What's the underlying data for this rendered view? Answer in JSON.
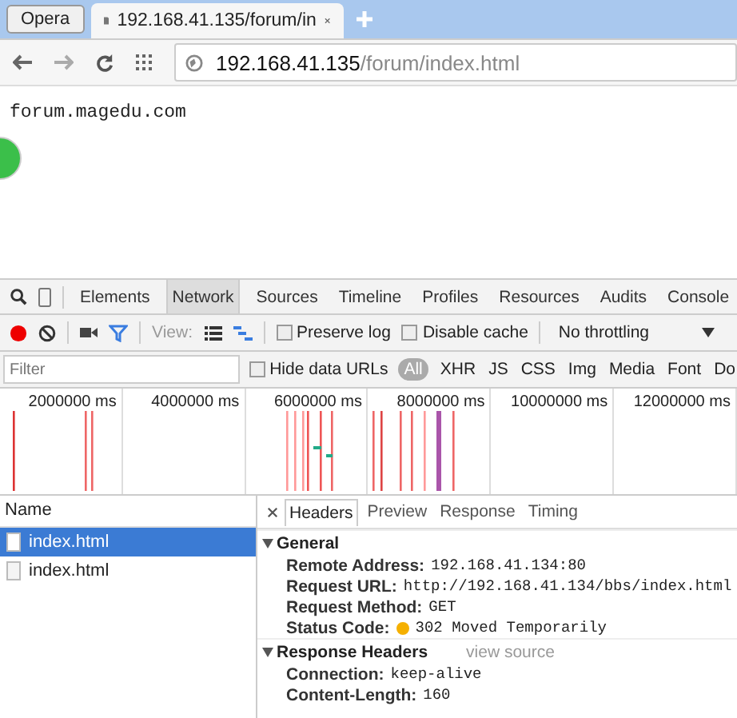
{
  "browser": {
    "menu_button": "Opera",
    "tabs": [
      {
        "title": "192.168.41.135/forum/in",
        "selected": true
      }
    ],
    "address": {
      "host": "192.168.41.135",
      "path": "/forum/index.html"
    }
  },
  "page": {
    "text": "forum.magedu.com"
  },
  "devtools": {
    "panels": [
      {
        "label": "Elements",
        "selected": false
      },
      {
        "label": "Network",
        "selected": true
      },
      {
        "label": "Sources",
        "selected": false
      },
      {
        "label": "Timeline",
        "selected": false
      },
      {
        "label": "Profiles",
        "selected": false
      },
      {
        "label": "Resources",
        "selected": false
      },
      {
        "label": "Audits",
        "selected": false
      },
      {
        "label": "Console",
        "selected": false
      }
    ],
    "toolbar": {
      "recording": true,
      "filter_on": true,
      "view_label": "View:",
      "preserve_log": {
        "label": "Preserve log",
        "checked": false
      },
      "disable_cache": {
        "label": "Disable cache",
        "checked": false
      },
      "throttling": "No throttling"
    },
    "filter": {
      "placeholder": "Filter",
      "hide_data_urls": {
        "label": "Hide data URLs",
        "checked": false
      },
      "types": [
        {
          "label": "All",
          "selected": true
        },
        {
          "label": "XHR",
          "selected": false
        },
        {
          "label": "JS",
          "selected": false
        },
        {
          "label": "CSS",
          "selected": false
        },
        {
          "label": "Img",
          "selected": false
        },
        {
          "label": "Media",
          "selected": false
        },
        {
          "label": "Font",
          "selected": false
        },
        {
          "label": "Do",
          "selected": false
        }
      ]
    },
    "overview": {
      "ticks": [
        "2000000 ms",
        "4000000 ms",
        "6000000 ms",
        "8000000 ms",
        "10000000 ms",
        "12000000 ms"
      ]
    },
    "requests": {
      "header": "Name",
      "items": [
        {
          "name": "index.html",
          "selected": true
        },
        {
          "name": "index.html",
          "selected": false
        }
      ]
    },
    "detail_tabs": [
      {
        "label": "Headers",
        "selected": true
      },
      {
        "label": "Preview",
        "selected": false
      },
      {
        "label": "Response",
        "selected": false
      },
      {
        "label": "Timing",
        "selected": false
      }
    ],
    "sections": [
      {
        "title": "General",
        "expanded": true,
        "rows": [
          {
            "key": "Remote Address:",
            "value": "192.168.41.134:80"
          },
          {
            "key": "Request URL:",
            "value": "http://192.168.41.134/bbs/index.html"
          },
          {
            "key": "Request Method:",
            "value": "GET"
          },
          {
            "key": "Status Code:",
            "value": "302 Moved Temporarily",
            "color": "#f5b000"
          }
        ]
      },
      {
        "title": "Response Headers",
        "expanded": true,
        "link": "view source",
        "rows": [
          {
            "key": "Connection:",
            "value": "keep-alive"
          },
          {
            "key": "Content-Length:",
            "value": "160"
          }
        ]
      }
    ]
  }
}
